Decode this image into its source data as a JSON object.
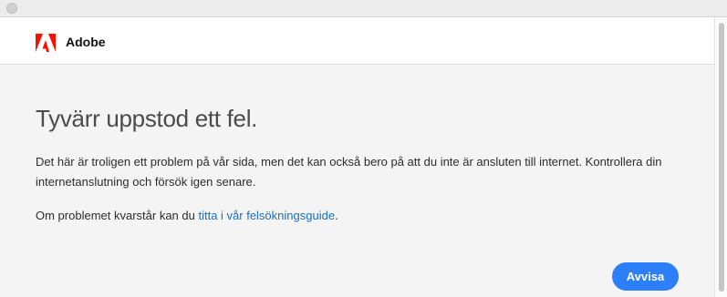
{
  "brand": {
    "name": "Adobe",
    "logo_icon": "adobe-logo-icon",
    "color": "#fa0f00"
  },
  "error": {
    "title": "Tyvärr uppstod ett fel.",
    "message": "Det här är troligen ett problem på vår sida, men det kan också bero på att du inte är ansluten till internet. Kontrollera din internetanslutning och försök igen senare.",
    "help_prefix": "Om problemet kvarstår kan du ",
    "help_link": "titta i vår felsökningsguide",
    "help_suffix": "."
  },
  "actions": {
    "dismiss_label": "Avvisa",
    "accent_color": "#2d7ff9"
  }
}
